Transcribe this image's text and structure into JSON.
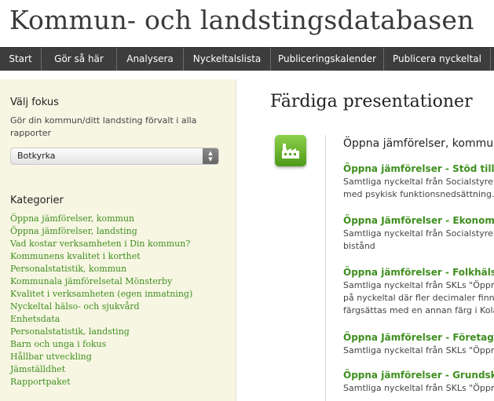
{
  "site": {
    "title": "Kommun- och landstingsdatabasen"
  },
  "nav": {
    "items": [
      {
        "label": "Start"
      },
      {
        "label": "Gör så här"
      },
      {
        "label": "Analysera"
      },
      {
        "label": "Nyckeltalslista"
      },
      {
        "label": "Publiceringskalender"
      },
      {
        "label": "Publicera nyckeltal"
      }
    ]
  },
  "sidebar": {
    "focus_title": "Välj fokus",
    "focus_description": "Gör din kommun/ditt landsting förvalt i alla rapporter",
    "focus_select_value": "Botkyrka",
    "categories_title": "Kategorier",
    "categories": [
      "Öppna jämförelser, kommun",
      "Öppna jämförelser, landsting",
      "Vad kostar verksamheten i Din kommun?",
      "Kommunens kvalitet i korthet",
      "Personalstatistik, kommun",
      "Kommunala jämförelsetal Mönsterby",
      "Kvalitet i verksamheten (egen inmatning)",
      "Nyckeltal hälso- och sjukvård",
      "Enhetsdata",
      "Personalstatistik, landsting",
      "Barn och unga i fokus",
      "Hållbar utveckling",
      "Jämställdhet",
      "Rapportpaket"
    ]
  },
  "main": {
    "title": "Färdiga presentationer",
    "group_title": "Öppna jämförelser, kommun",
    "icon": "factory-icon",
    "presentations": [
      {
        "title": "Öppna jämförelser - Stöd till pe",
        "desc": [
          "Samtliga nyckeltal från Socialstyrels",
          "med psykisk funktionsnedsättning."
        ]
      },
      {
        "title": "Öppna Jämförelser - Ekonomisk",
        "desc": [
          "Samtliga nyckeltal från Socialstyrels",
          "bistånd"
        ]
      },
      {
        "title": "Öppna jämförelser - Folkhälsa, l",
        "desc": [
          "Samtliga nyckeltal från SKLs \"Öppna",
          "på nyckeltal där fler decimaler finns",
          "färgsättas med en annan färg i Kola"
        ]
      },
      {
        "title": "Öppna Jämförelser - Företagskli",
        "desc": [
          "Samtliga nyckeltal från SKLs \"Öppna"
        ]
      },
      {
        "title": "Öppna jämförelser - Grundskola",
        "desc": [
          "Samtliga nyckeltal från SKLs \"Öppna"
        ]
      }
    ]
  },
  "colors": {
    "link_green": "#3f8f1f",
    "nav_bg": "#3d3d3d",
    "sidebar_bg": "#f7f6e3"
  }
}
